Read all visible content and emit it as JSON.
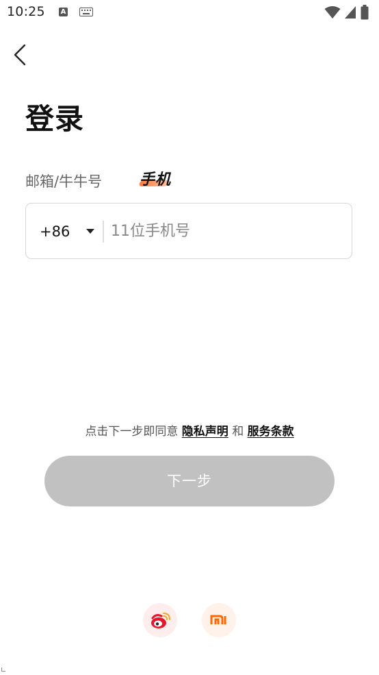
{
  "status_bar": {
    "time": "10:25",
    "notification_icon": "a-letter-icon",
    "keyboard_icon": "keyboard-icon",
    "wifi_icon": "wifi-icon",
    "signal_icon": "cell-signal-icon",
    "battery_icon": "battery-icon"
  },
  "header": {
    "back_icon": "chevron-left-icon",
    "title": "登录"
  },
  "tabs": {
    "email_label": "邮箱/牛牛号",
    "phone_label": "手机",
    "active": "phone",
    "active_underline_color": "#ff7a3c"
  },
  "phone_input": {
    "country_code": "+86",
    "value": "",
    "placeholder": "11位手机号"
  },
  "agreement": {
    "prefix": "点击下一步即同意",
    "privacy_link": "隐私声明",
    "connector": "和",
    "terms_link": "服务条款"
  },
  "next_button": {
    "label": "下一步",
    "color": "#c1c1c1"
  },
  "social_login": {
    "weibo_icon": "weibo-icon",
    "xiaomi_icon": "xiaomi-icon",
    "weibo_color": "#e6162d",
    "xiaomi_color": "#ff6700"
  }
}
